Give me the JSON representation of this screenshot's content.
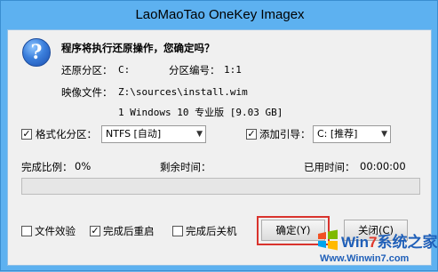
{
  "window": {
    "title": "LaoMaoTao OneKey Imagex"
  },
  "prompt": {
    "question": "程序将执行还原操作，您确定吗？",
    "restore_partition_label": "还原分区：",
    "restore_partition_value": "C:",
    "partition_number_label": "分区编号：",
    "partition_number_value": "1:1",
    "image_file_label": "映像文件：",
    "image_file_value": "Z:\\sources\\install.wim",
    "image_index_value": "1 Windows 10 专业版 [9.03 GB]"
  },
  "format_option": {
    "label": "格式化分区：",
    "checked": true,
    "select_value": "NTFS [自动]"
  },
  "boot_option": {
    "label": "添加引导：",
    "checked": true,
    "select_value": "C: [推荐]"
  },
  "status": {
    "completed_label": "完成比例：",
    "completed_value": "0%",
    "remaining_label": "剩余时间：",
    "remaining_value": "",
    "elapsed_label": "已用时间：",
    "elapsed_value": "00:00:00",
    "progress_fraction": 0
  },
  "options": {
    "verify_label": "文件效验",
    "verify_checked": false,
    "reboot_label": "完成后重启",
    "reboot_checked": true,
    "shutdown_label": "完成后关机",
    "shutdown_checked": false
  },
  "buttons": {
    "ok_label": "确定(Y)",
    "close_label": "关闭(C)"
  },
  "watermark": {
    "brand_prefix": "Win",
    "brand_seven": "7",
    "brand_suffix": "系统之家",
    "url": "Www.Winwin7.com"
  },
  "colors": {
    "title_bg": "#5db1f0",
    "highlight": "#d9332d",
    "progress_fill": "#06b025"
  }
}
